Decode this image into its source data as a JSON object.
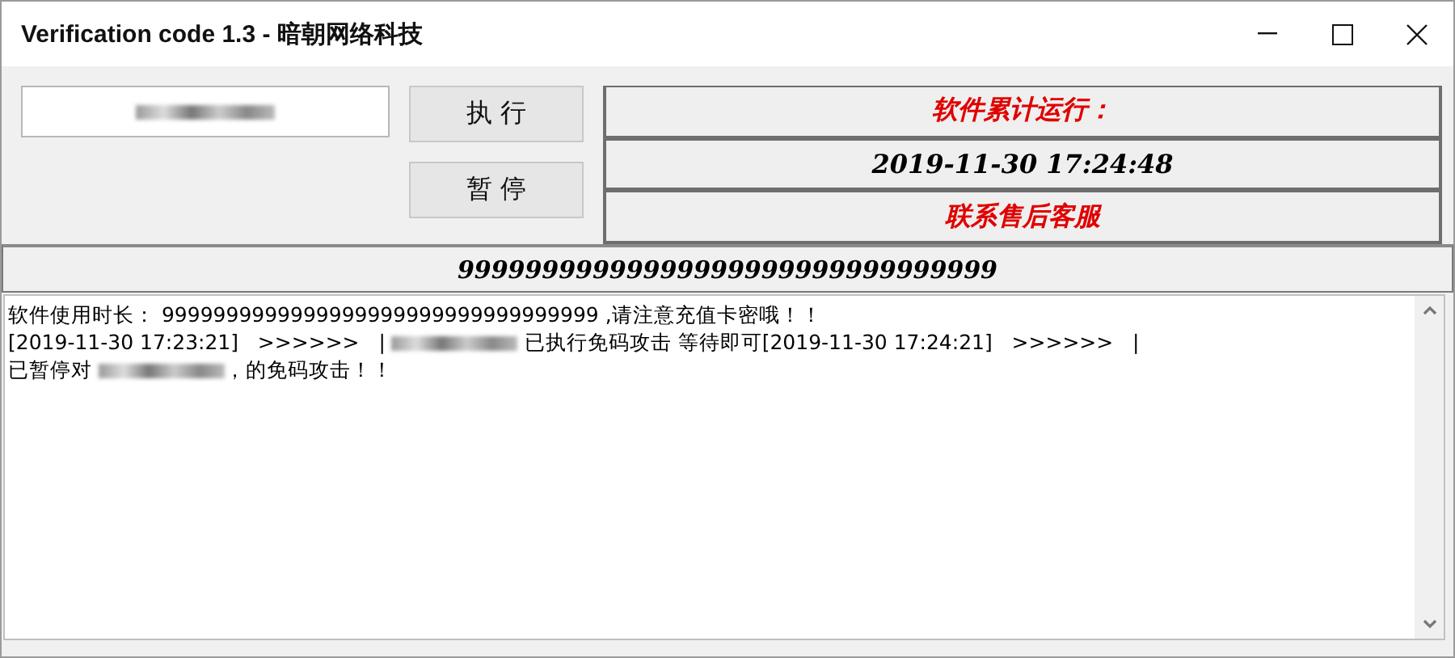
{
  "window": {
    "title": "Verification code 1.3 - 暗朝网络科技"
  },
  "code_field": {
    "value_redacted": true
  },
  "buttons": [
    {
      "label": "执 行"
    },
    {
      "label": "暂 停"
    }
  ],
  "info_panels": [
    {
      "text": "软件累计运行：",
      "color": "#e00000"
    },
    {
      "text": "2019-11-30 17:24:48",
      "color": "#000000"
    },
    {
      "text": "联系售后客服",
      "color": "#e00000"
    }
  ],
  "counter_bar": {
    "text": "99999999999999999999999999999999"
  },
  "log": {
    "lines": [
      [
        {
          "kind": "text",
          "text": "软件使用时长： 9999999999999999999999999999999999 ,请注意充值卡密哦！！"
        }
      ],
      [
        {
          "kind": "text",
          "text": "[2019-11-30 17:23:21]   >>>>>>   | "
        },
        {
          "kind": "redacted"
        },
        {
          "kind": "text",
          "text": " 已执行免码攻击 等待即可[2019-11-30 17:24:21]   >>>>>>   |"
        }
      ],
      [
        {
          "kind": "text",
          "text": "已暂停对 "
        },
        {
          "kind": "redacted"
        },
        {
          "kind": "text",
          "text": "，的免码攻击！！"
        }
      ]
    ]
  }
}
